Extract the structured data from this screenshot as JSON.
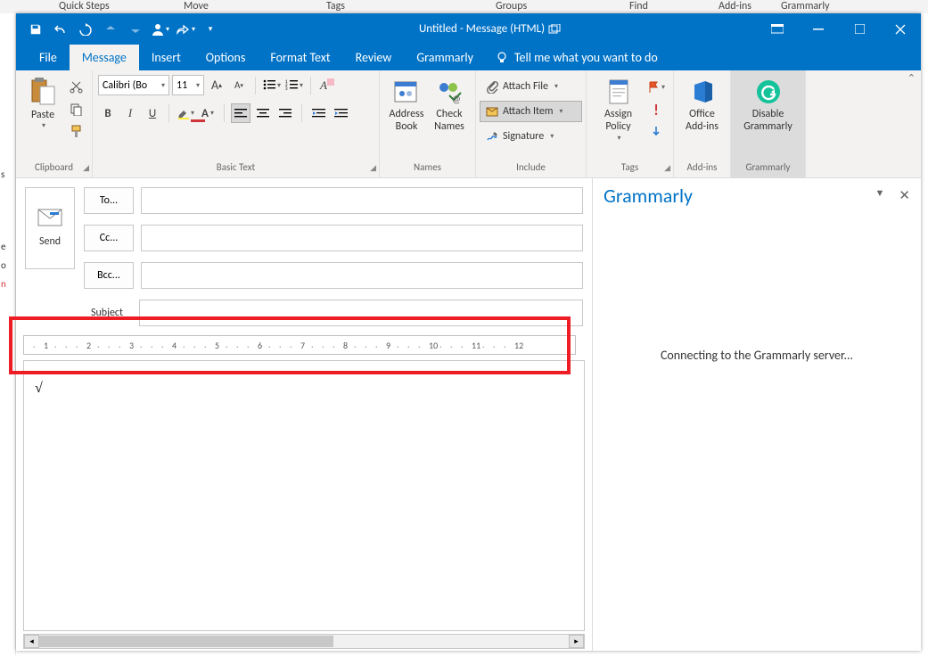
{
  "bg_groups": [
    "Quick Steps",
    "Move",
    "Tags",
    "Groups",
    "Find",
    "Add-ins",
    "Grammarly"
  ],
  "title": "Untitled  -  Message (HTML)",
  "tabs": {
    "file": "File",
    "message": "Message",
    "insert": "Insert",
    "options": "Options",
    "format": "Format Text",
    "review": "Review",
    "grammarly": "Grammarly",
    "tellme": "Tell me what you want to do"
  },
  "clipboard": {
    "paste": "Paste",
    "label": "Clipboard"
  },
  "basictext": {
    "fontname": "Calibri (Bo",
    "fontsize": "11",
    "label": "Basic Text"
  },
  "names": {
    "address": "Address Book",
    "check": "Check Names",
    "label": "Names"
  },
  "include": {
    "attach_file": "Attach File",
    "attach_item": "Attach Item",
    "signature": "Signature",
    "label": "Include"
  },
  "tags": {
    "assign": "Assign Policy",
    "label": "Tags"
  },
  "addins": {
    "office": "Office Add-ins",
    "label": "Add-ins"
  },
  "grammarlygrp": {
    "disable": "Disable Grammarly",
    "label": "Grammarly"
  },
  "compose": {
    "send": "Send",
    "to": "To...",
    "cc": "Cc...",
    "bcc": "Bcc...",
    "subject": "Subject"
  },
  "ruler_marks": [
    "1",
    "2",
    "3",
    "4",
    "5",
    "6",
    "7",
    "8",
    "9",
    "10",
    "11",
    "12"
  ],
  "panel": {
    "title": "Grammarly",
    "status": "Connecting to the Grammarly server..."
  }
}
